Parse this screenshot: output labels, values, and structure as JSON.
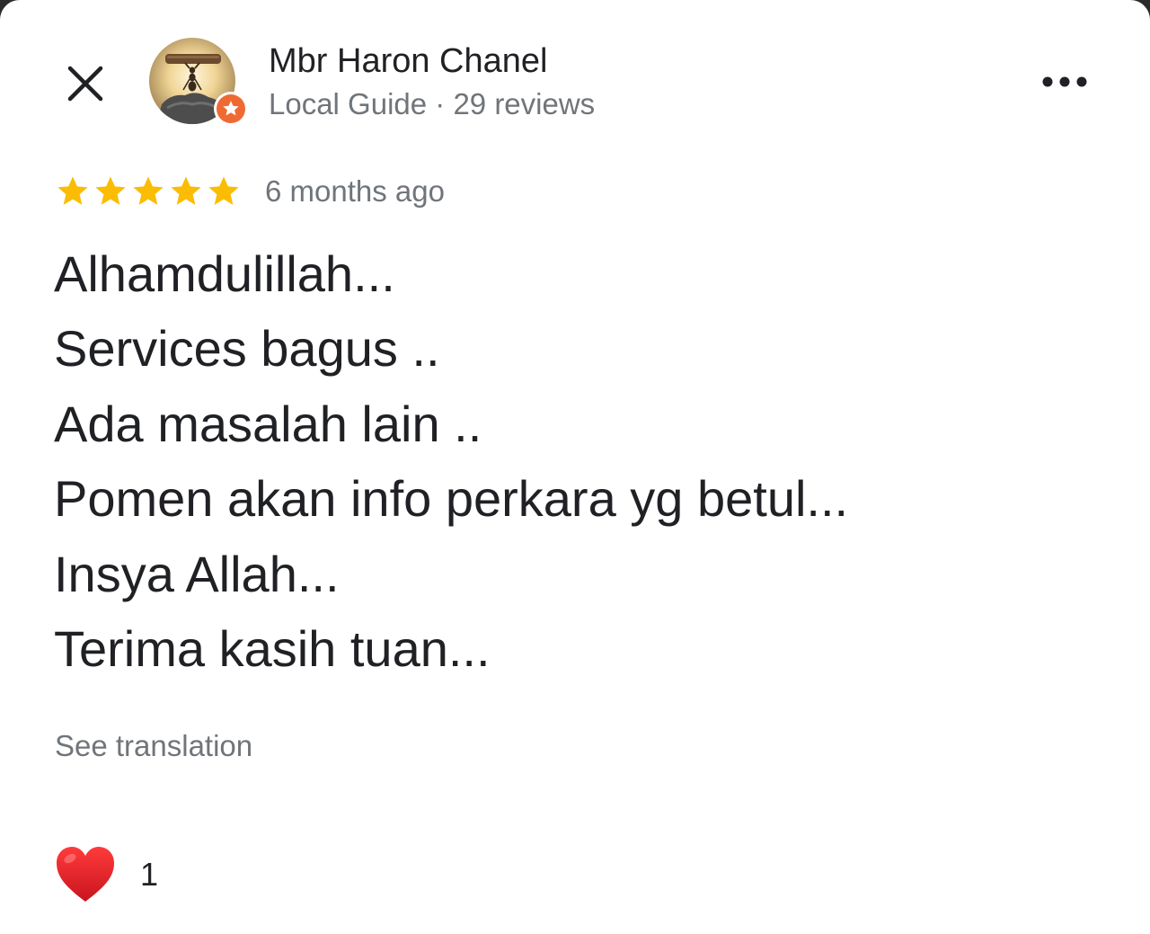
{
  "header": {
    "close_icon": "close-icon",
    "more_icon": "more-horizontal-icon"
  },
  "author": {
    "name": "Mbr Haron Chanel",
    "meta": "Local Guide · 29 reviews",
    "badge_icon": "local-guide-star-icon"
  },
  "review": {
    "rating": 5,
    "rating_max": 5,
    "date": "6 months ago",
    "lines": [
      "Alhamdulillah...",
      "Services bagus ..",
      "Ada masalah lain ..",
      "Pomen akan info perkara yg betul...",
      "Insya Allah...",
      "Terima kasih tuan..."
    ],
    "see_translation": "See translation"
  },
  "reactions": {
    "heart_icon": "heart-icon",
    "count": "1"
  },
  "colors": {
    "star": "#fbbc04",
    "badge": "#ef6a33",
    "heart": "#e0242f",
    "secondary_text": "#70757a"
  }
}
